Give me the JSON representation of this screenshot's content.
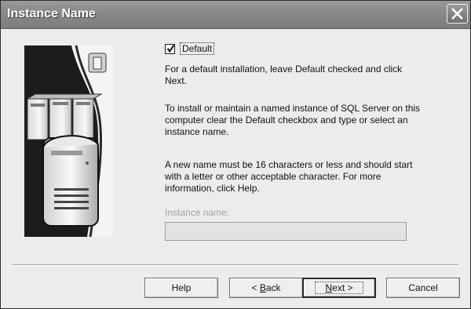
{
  "window": {
    "title": "Instance Name"
  },
  "default_checkbox": {
    "label": "Default",
    "checked": true
  },
  "paragraphs": {
    "p1": "For a default installation, leave Default checked and click Next.",
    "p2": "To install or maintain a named instance of SQL Server on this computer clear the Default checkbox and type or select an instance name.",
    "p3": "A new name must be 16 characters or less and should start with a letter or other acceptable character.  For more information, click Help."
  },
  "instance_name_field": {
    "label": "Instance name:",
    "value": "",
    "enabled": false
  },
  "buttons": {
    "help": "Help",
    "back_mnemonic": "B",
    "back_rest": "ack",
    "back_prefix": "< ",
    "next_mnemonic": "N",
    "next_rest": "ext >",
    "cancel": "Cancel"
  },
  "icons": {
    "close": "close-icon",
    "banner": "server-banner-icon"
  }
}
